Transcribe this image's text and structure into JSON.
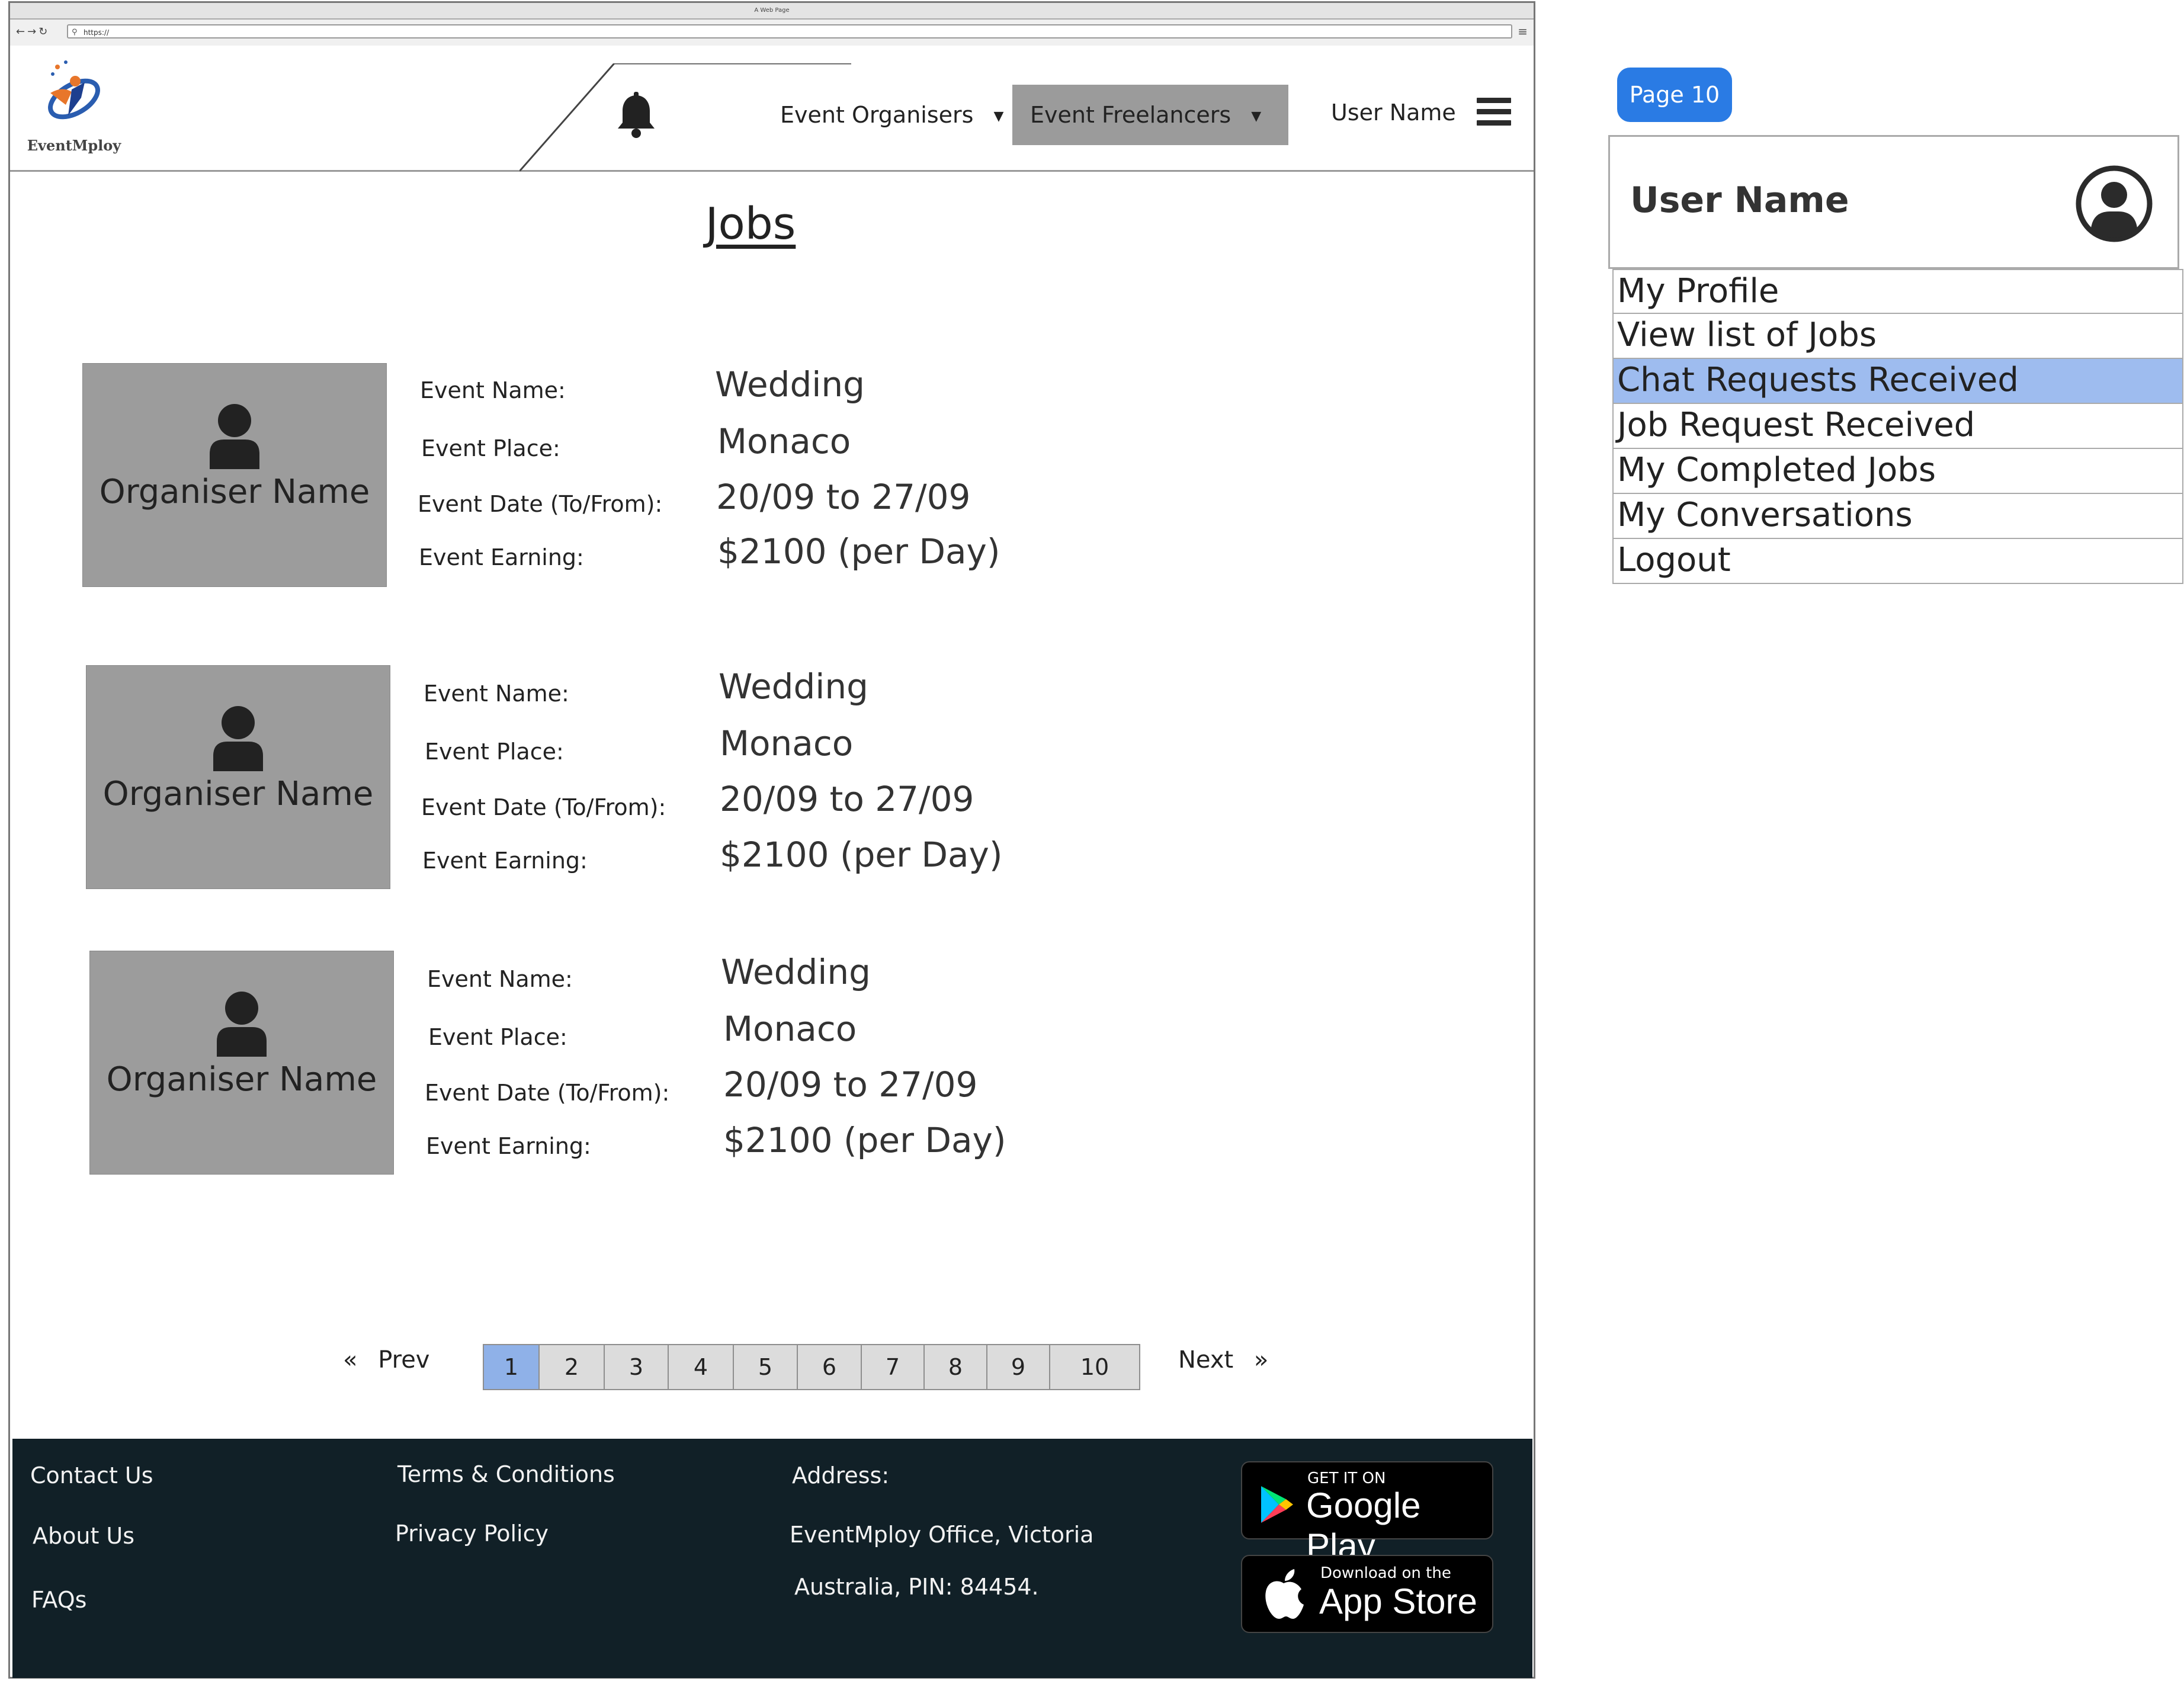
{
  "browser": {
    "window_title": "A Web Page",
    "url": "https://"
  },
  "header": {
    "logo_text": "EventMploy",
    "nav": {
      "organisers": "Event Organisers",
      "freelancers": "Event Freelancers",
      "user": "User Name"
    },
    "icons": [
      "bell-icon",
      "hamburger-menu-icon",
      "chevron-down-icon"
    ]
  },
  "main": {
    "title": "Jobs",
    "labels": {
      "name": "Event Name:",
      "place": "Event Place:",
      "date": "Event Date (To/From):",
      "earning": "Event Earning:"
    },
    "jobs": [
      {
        "organiser": "Organiser Name",
        "name": "Wedding",
        "place": "Monaco",
        "date": "20/09 to 27/09",
        "earning": "$2100 (per Day)"
      },
      {
        "organiser": "Organiser Name",
        "name": "Wedding",
        "place": "Monaco",
        "date": "20/09 to 27/09",
        "earning": "$2100 (per Day)"
      },
      {
        "organiser": "Organiser Name",
        "name": "Wedding",
        "place": "Monaco",
        "date": "20/09 to 27/09",
        "earning": "$2100 (per Day)"
      }
    ]
  },
  "pagination": {
    "prev_label": "Prev",
    "next_label": "Next",
    "pages": [
      "1",
      "2",
      "3",
      "4",
      "5",
      "6",
      "7",
      "8",
      "9",
      "10"
    ],
    "current": "1"
  },
  "footer": {
    "contact": "Contact Us",
    "about": "About Us",
    "faqs": "FAQs",
    "terms": "Terms & Conditions",
    "privacy": "Privacy Policy",
    "address_label": "Address:",
    "address_line1": "EventMploy Office, Victoria",
    "address_line2": "Australia, PIN: 84454.",
    "google_small": "GET IT ON",
    "google_big": "Google Play",
    "apple_small": "Download on the",
    "apple_big": "App Store"
  },
  "side_menu": {
    "page_tag": "Page 10",
    "user_name": "User Name",
    "items": [
      {
        "label": "My Profile",
        "highlight": false
      },
      {
        "label": "View list of Jobs",
        "highlight": false
      },
      {
        "label": "Chat Requests Received",
        "highlight": true
      },
      {
        "label": "Job Request Received",
        "highlight": false
      },
      {
        "label": "My Completed Jobs",
        "highlight": false
      },
      {
        "label": "My Conversations",
        "highlight": false
      },
      {
        "label": "Logout",
        "highlight": false
      }
    ]
  },
  "colors": {
    "footer_bg": "#112027",
    "nav_active_bg": "#9b9b9b",
    "page_tag_bg": "#2a7be4",
    "menu_highlight": "#9ebcef",
    "pager_active": "#8fb1e8",
    "photo_bg": "#9c9c9c"
  }
}
